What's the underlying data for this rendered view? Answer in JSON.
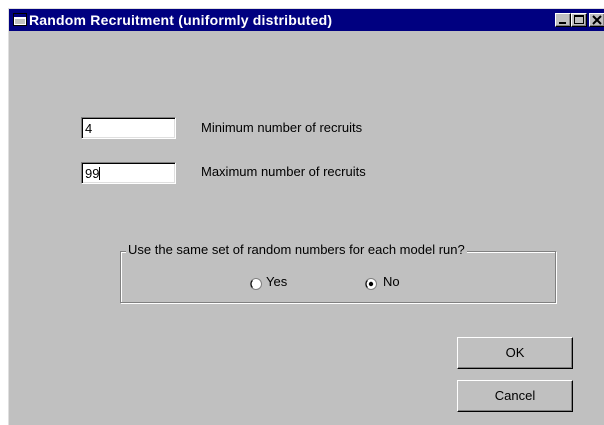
{
  "window": {
    "title": "Random Recruitment (uniformly distributed)",
    "titlebar_color": "#000080",
    "background_color": "#c0c0c0",
    "controls": {
      "minimize_icon": "minimize-icon",
      "maximize_icon": "maximize-icon",
      "close_icon": "close-icon"
    }
  },
  "fields": {
    "min_recruits": {
      "value": "4",
      "label": "Minimum number of recruits"
    },
    "max_recruits": {
      "value": "99",
      "label": "Maximum number of recruits"
    }
  },
  "random_numbers_group": {
    "legend": "Use the same set of random numbers for each model run?",
    "options": [
      {
        "label": "Yes",
        "selected": false
      },
      {
        "label": "No",
        "selected": true
      }
    ]
  },
  "buttons": {
    "ok": "OK",
    "cancel": "Cancel"
  }
}
